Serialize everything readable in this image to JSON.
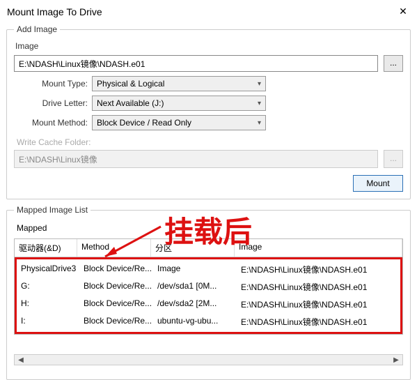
{
  "window": {
    "title": "Mount Image To Drive",
    "close": "✕"
  },
  "addImage": {
    "legend": "Add Image",
    "imageLabel": "Image",
    "imageValue": "E:\\NDASH\\Linux镜像\\NDASH.e01",
    "browse": "...",
    "mountTypeLabel": "Mount Type:",
    "mountTypeValue": "Physical & Logical",
    "driveLetterLabel": "Drive Letter:",
    "driveLetterValue": "Next Available (J:)",
    "mountMethodLabel": "Mount Method:",
    "mountMethodValue": "Block Device / Read Only",
    "cacheLabel": "Write Cache Folder:",
    "cacheValue": "E:\\NDASH\\Linux镜像",
    "cacheBrowse": "...",
    "mountBtn": "Mount"
  },
  "mapped": {
    "legend": "Mapped Image List",
    "subtitle": "Mapped",
    "headers": {
      "c1": "驱动器(&D)",
      "c2": "Method",
      "c3": "分区",
      "c4": "Image"
    },
    "rows": [
      {
        "c1": "PhysicalDrive3",
        "c2": "Block Device/Re...",
        "c3": "Image",
        "c4": "E:\\NDASH\\Linux镜像\\NDASH.e01"
      },
      {
        "c1": "G:",
        "c2": "Block Device/Re...",
        "c3": "/dev/sda1 [0M...",
        "c4": "E:\\NDASH\\Linux镜像\\NDASH.e01"
      },
      {
        "c1": "H:",
        "c2": "Block Device/Re...",
        "c3": "/dev/sda2 [2M...",
        "c4": "E:\\NDASH\\Linux镜像\\NDASH.e01"
      },
      {
        "c1": "I:",
        "c2": "Block Device/Re...",
        "c3": "ubuntu-vg-ubu...",
        "c4": "E:\\NDASH\\Linux镜像\\NDASH.e01"
      }
    ]
  },
  "overlay": {
    "text": "挂载后"
  },
  "scroll": {
    "left": "◀",
    "right": "▶"
  }
}
